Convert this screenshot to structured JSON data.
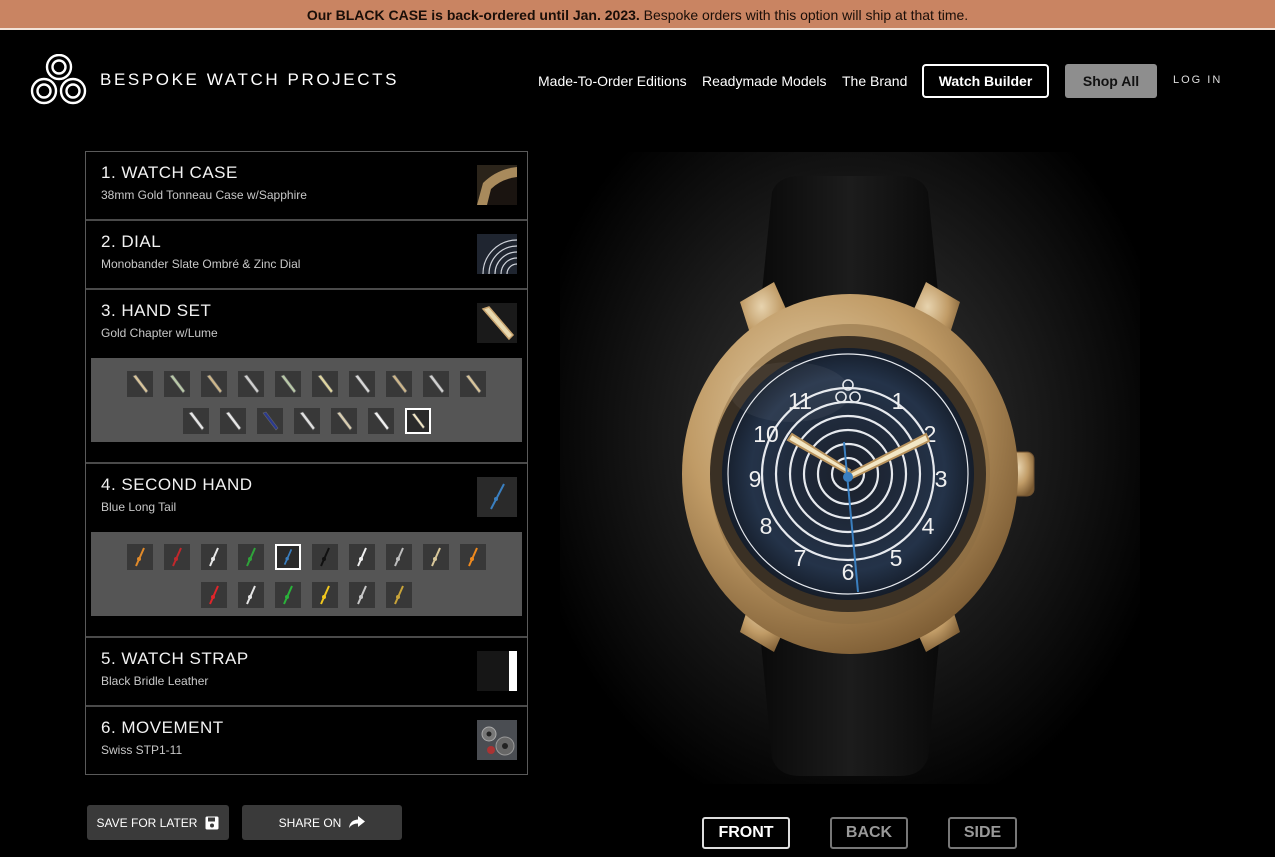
{
  "banner": {
    "bold": "Our BLACK CASE is back-ordered until Jan. 2023.",
    "text": " Bespoke orders with this option will ship at that time."
  },
  "header": {
    "brand": "BESPOKE WATCH PROJECTS",
    "nav": [
      "Made-To-Order Editions",
      "Readymade Models",
      "The Brand"
    ],
    "builder_label": "Watch Builder",
    "shop_label": "Shop All",
    "login_label": "LOG IN"
  },
  "sections": [
    {
      "title": "1. WATCH CASE",
      "subtitle": "38mm Gold Tonneau Case w/Sapphire"
    },
    {
      "title": "2. DIAL",
      "subtitle": "Monobander Slate Ombré & Zinc Dial"
    },
    {
      "title": "3. HAND SET",
      "subtitle": "Gold Chapter w/Lume"
    },
    {
      "title": "4. SECOND HAND",
      "subtitle": "Blue Long Tail"
    },
    {
      "title": "5. WATCH STRAP",
      "subtitle": "Black Bridle Leather"
    },
    {
      "title": "6. MOVEMENT",
      "subtitle": "Swiss STP1-11"
    }
  ],
  "handset_options": {
    "selected_index": 16,
    "count": 17
  },
  "second_hand_options": {
    "colors": [
      "#e08a2a",
      "#c0282c",
      "#e8e8e8",
      "#2fa33a",
      "#3a7fc0",
      "#111111",
      "#f0f0f0",
      "#bdbdbd",
      "#d8c79a",
      "#f08a1e",
      "#e0252a",
      "#e6e6e6",
      "#2ab33a",
      "#f2c81e",
      "#c8c8c8",
      "#c8a43a"
    ],
    "selected_index": 4
  },
  "actions": {
    "save_label": "SAVE FOR LATER",
    "share_label": "SHARE ON"
  },
  "views": {
    "front": "FRONT",
    "back": "BACK",
    "side": "SIDE"
  },
  "dial_numerals": [
    "1",
    "2",
    "3",
    "4",
    "5",
    "6",
    "7",
    "8",
    "9",
    "10",
    "11"
  ],
  "colors": {
    "banner": "#c98462",
    "gold": "#c9a571",
    "dial": "#1c2636",
    "second_hand": "#3a7fc0"
  }
}
